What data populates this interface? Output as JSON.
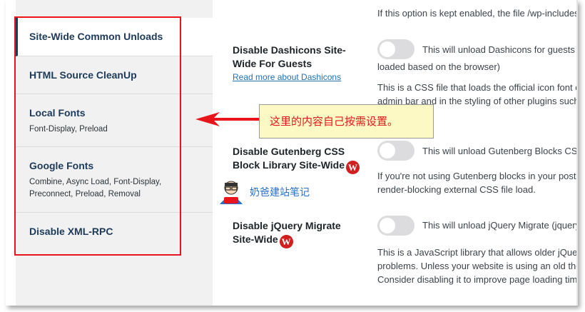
{
  "sidebar": {
    "items": [
      {
        "title": "Site-Wide Common Unloads",
        "sub": ""
      },
      {
        "title": "HTML Source CleanUp",
        "sub": ""
      },
      {
        "title": "Local Fonts",
        "sub": "Font-Display, Preload"
      },
      {
        "title": "Google Fonts",
        "sub": "Combine, Async Load, Font-Display, Preconnect, Preload, Removal"
      },
      {
        "title": "Disable XML-RPC",
        "sub": ""
      }
    ],
    "google_sub_line1": "Combine, Async Load, Font-Display,",
    "google_sub_line2": "Preconnect, Preload, Removal"
  },
  "callout": {
    "text": "这里的内容自己按需设置。"
  },
  "watermark": {
    "text": "奶爸建站笔记"
  },
  "content": {
    "top_line": "If this option is kept enabled, the file /wp-includes/",
    "dashicons": {
      "label_line1": "Disable Dashicons Site-",
      "label_line2": "Wide For Guests",
      "link": "Read more about Dashicons",
      "toggle_text": "This will unload Dashicons for guests (n",
      "toggle_text_2": "loaded based on the browser)",
      "desc_line1": "This is a CSS file that loads the official icon font of",
      "desc_line2": "admin bar and in the styling of other plugins such"
    },
    "gutenberg": {
      "label_line1": "Disable Gutenberg CSS",
      "label_line2": "Block Library Site-Wide",
      "toggle_text": "This will unload Gutenberg Blocks CSS f",
      "desc_line1": "If you're not using Gutenberg blocks in your posts,",
      "desc_line2": "render-blocking external CSS file load."
    },
    "jquery": {
      "label_line1": "Disable jQuery Migrate",
      "label_line2": "Site-Wide",
      "toggle_text": "This will unload jQuery Migrate (jquery-",
      "desc_line1": "This is a JavaScript library that allows older jQuery",
      "desc_line2": "problems. Unless your website is using an old ther",
      "desc_line3": "Consider disabling it to improve page loading time"
    },
    "wp_icon_glyph": "W"
  },
  "colors": {
    "accent_red": "#e8161c",
    "nav_text": "#1d3a58",
    "link": "#2271b1",
    "callout_bg": "#fdf9c5"
  }
}
